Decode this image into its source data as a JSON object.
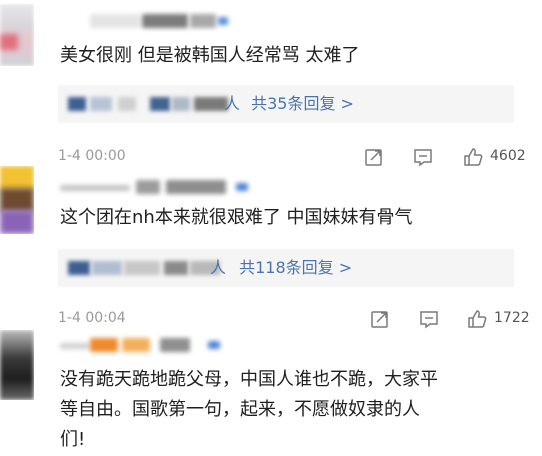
{
  "comments": [
    {
      "text": "美女很刚 但是被韩国人经常骂 太难了",
      "reply_suffix_person": "人",
      "reply_summary": "共35条回复 >",
      "timestamp": "1-4 00:00",
      "like_count": "4602"
    },
    {
      "text": "这个团在nh本来就很艰难了 中国妹妹有骨气",
      "reply_suffix_person": "人",
      "reply_summary": "共118条回复 >",
      "timestamp": "1-4 00:04",
      "like_count": "1722"
    },
    {
      "text_lines": [
        "没有跪天跪地跪父母，中国人谁也不跪，大家平",
        "等自由。国歌第一句，起来，不愿做奴隶的人",
        "们!"
      ]
    }
  ],
  "icons": [
    "share-icon",
    "comment-icon",
    "like-icon"
  ],
  "colors": {
    "link": "#4a74b0",
    "reply_bg": "#f5f5f5",
    "meta": "#9a9a9a"
  }
}
